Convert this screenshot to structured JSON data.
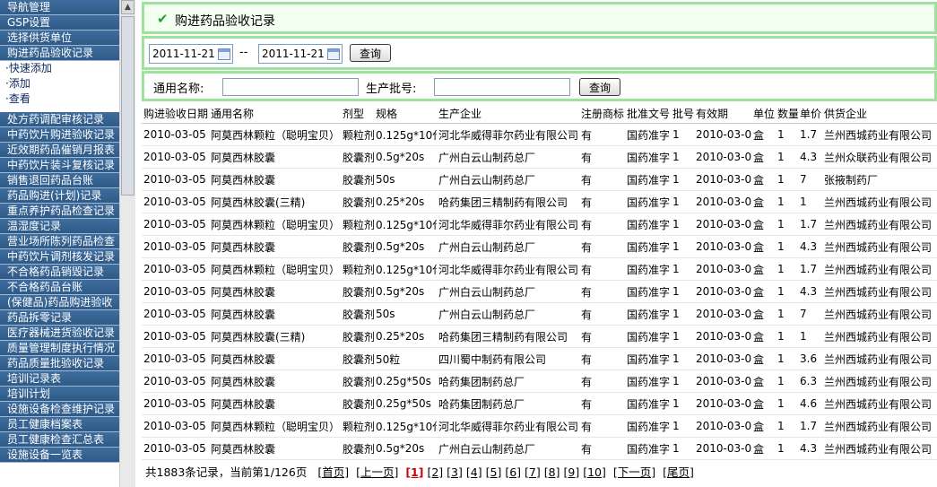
{
  "sidebar": {
    "top_items": [
      "导航管理",
      "GSP设置",
      "选择供货单位",
      "购进药品验收记录"
    ],
    "sub_items": [
      "·快速添加",
      "·添加",
      "·查看"
    ],
    "items": [
      "处方药调配审核记录",
      "中药饮片购进验收记录",
      "近效期药品催销月报表",
      "中药饮片装斗复核记录",
      "销售退回药品台账",
      "药品购进(计划)记录",
      "重点养护药品检查记录",
      "温湿度记录",
      "营业场所陈列药品检查",
      "中药饮片调剂核发记录",
      "不合格药品销毁记录",
      "不合格药品台账",
      "(保健品)药品购进验收",
      "药品拆零记录",
      "医疗器械进货验收记录",
      "质量管理制度执行情况",
      "药品质量批验收记录",
      "培训记录表",
      "培训计划",
      "设施设备检查维护记录",
      "员工健康档案表",
      "员工健康检查汇总表",
      "设施设备一览表"
    ]
  },
  "header": {
    "title": "购进药品验收记录"
  },
  "date_filter": {
    "start": "2011-11-21",
    "separator": "--",
    "end": "2011-11-21",
    "query_label": "查询"
  },
  "search": {
    "name_label": "通用名称:",
    "batch_label": "生产批号:",
    "query_label": "查询"
  },
  "table": {
    "columns": [
      "购进验收日期",
      "通用名称",
      "剂型",
      "规格",
      "生产企业",
      "注册商标",
      "批准文号",
      "批号",
      "有效期",
      "单位",
      "数量",
      "单价",
      "供货企业"
    ],
    "rows": [
      [
        "2010-03-05",
        "阿莫西林颗粒（聪明宝贝）",
        "颗粒剂",
        "0.125g*10代",
        "河北华威得菲尔药业有限公司",
        "有",
        "国药准字",
        "1",
        "2010-03-05",
        "盒",
        "1",
        "1.7",
        "兰州西城药业有限公司"
      ],
      [
        "2010-03-05",
        "阿莫西林胶囊",
        "胶囊剂",
        "0.5g*20s",
        "广州白云山制药总厂",
        "有",
        "国药准字",
        "1",
        "2010-03-05",
        "盒",
        "1",
        "4.3",
        "兰州众联药业有限公司"
      ],
      [
        "2010-03-05",
        "阿莫西林胶囊",
        "胶囊剂",
        "50s",
        "广州白云山制药总厂",
        "有",
        "国药准字",
        "1",
        "2010-03-05",
        "盒",
        "1",
        "7",
        "张掖制药厂"
      ],
      [
        "2010-03-05",
        "阿莫西林胶囊(三精)",
        "胶囊剂",
        "0.25*20s",
        "哈药集团三精制药有限公司",
        "有",
        "国药准字",
        "1",
        "2010-03-05",
        "盒",
        "1",
        "1",
        "兰州西城药业有限公司"
      ],
      [
        "2010-03-05",
        "阿莫西林颗粒（聪明宝贝）",
        "颗粒剂",
        "0.125g*10代",
        "河北华威得菲尔药业有限公司",
        "有",
        "国药准字",
        "1",
        "2010-03-05",
        "盒",
        "1",
        "1.7",
        "兰州西城药业有限公司"
      ],
      [
        "2010-03-05",
        "阿莫西林胶囊",
        "胶囊剂",
        "0.5g*20s",
        "广州白云山制药总厂",
        "有",
        "国药准字",
        "1",
        "2010-03-05",
        "盒",
        "1",
        "4.3",
        "兰州西城药业有限公司"
      ],
      [
        "2010-03-05",
        "阿莫西林颗粒（聪明宝贝）",
        "颗粒剂",
        "0.125g*10代",
        "河北华威得菲尔药业有限公司",
        "有",
        "国药准字",
        "1",
        "2010-03-05",
        "盒",
        "1",
        "1.7",
        "兰州西城药业有限公司"
      ],
      [
        "2010-03-05",
        "阿莫西林胶囊",
        "胶囊剂",
        "0.5g*20s",
        "广州白云山制药总厂",
        "有",
        "国药准字",
        "1",
        "2010-03-05",
        "盒",
        "1",
        "4.3",
        "兰州西城药业有限公司"
      ],
      [
        "2010-03-05",
        "阿莫西林胶囊",
        "胶囊剂",
        "50s",
        "广州白云山制药总厂",
        "有",
        "国药准字",
        "1",
        "2010-03-05",
        "盒",
        "1",
        "7",
        "兰州西城药业有限公司"
      ],
      [
        "2010-03-05",
        "阿莫西林胶囊(三精)",
        "胶囊剂",
        "0.25*20s",
        "哈药集团三精制药有限公司",
        "有",
        "国药准字",
        "1",
        "2010-03-05",
        "盒",
        "1",
        "1",
        "兰州西城药业有限公司"
      ],
      [
        "2010-03-05",
        "阿莫西林胶囊",
        "胶囊剂",
        "50粒",
        "四川蜀中制药有限公司",
        "有",
        "国药准字",
        "1",
        "2010-03-05",
        "盒",
        "1",
        "3.6",
        "兰州西城药业有限公司"
      ],
      [
        "2010-03-05",
        "阿莫西林胶囊",
        "胶囊剂",
        "0.25g*50s",
        "哈药集团制药总厂",
        "有",
        "国药准字",
        "1",
        "2010-03-05",
        "盒",
        "1",
        "6.3",
        "兰州西城药业有限公司"
      ],
      [
        "2010-03-05",
        "阿莫西林胶囊",
        "胶囊剂",
        "0.25g*50s",
        "哈药集团制药总厂",
        "有",
        "国药准字",
        "1",
        "2010-03-05",
        "盒",
        "1",
        "4.6",
        "兰州西城药业有限公司"
      ],
      [
        "2010-03-05",
        "阿莫西林颗粒（聪明宝贝）",
        "颗粒剂",
        "0.125g*10代",
        "河北华威得菲尔药业有限公司",
        "有",
        "国药准字",
        "1",
        "2010-03-05",
        "盒",
        "1",
        "1.7",
        "兰州西城药业有限公司"
      ],
      [
        "2010-03-05",
        "阿莫西林胶囊",
        "胶囊剂",
        "0.5g*20s",
        "广州白云山制药总厂",
        "有",
        "国药准字",
        "1",
        "2010-03-05",
        "盒",
        "1",
        "4.3",
        "兰州西城药业有限公司"
      ]
    ]
  },
  "pager": {
    "summary": "共1883条记录，当前第1/126页",
    "first": "[首页]",
    "prev": "[上一页]",
    "pages": [
      "[1]",
      "[2]",
      "[3]",
      "[4]",
      "[5]",
      "[6]",
      "[7]",
      "[8]",
      "[9]",
      "[10]"
    ],
    "current_index": 0,
    "next": "[下一页]",
    "last": "[尾页]"
  }
}
